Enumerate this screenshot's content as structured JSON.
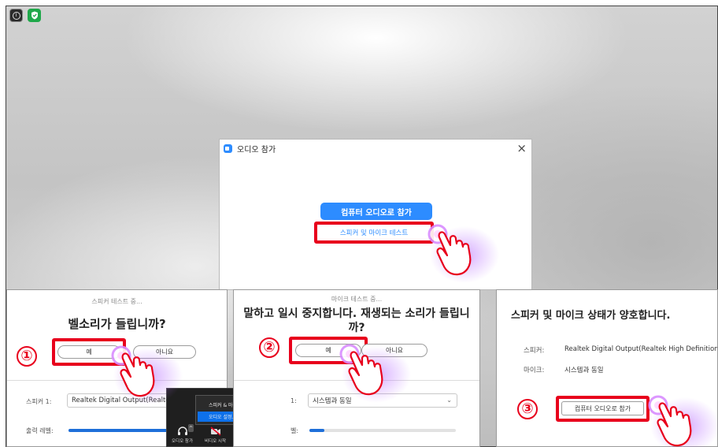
{
  "dialog": {
    "title": "오디오 참가",
    "close_glyph": "×",
    "join_button": "컴퓨터 오디오로 참가",
    "test_link": "스피커 및 마이크 테스트"
  },
  "panel1": {
    "caption": "스피커 테스트 중...",
    "question": "벨소리가 들립니까?",
    "step": "①",
    "yes": "예",
    "no": "아니요",
    "speaker_label": "스피커 1:",
    "speaker_value": "Realtek Digital Output(Realtek",
    "level_label": "출력 레벨:",
    "level_fraction": 0.77
  },
  "toolbar_popup": {
    "menu_items": [
      "스피커 & 마이크 테스트...",
      "오디오 설정..."
    ],
    "selected_index": 1,
    "audio_button": "오디오 참가",
    "video_button": "비디오 시작",
    "caret": "^"
  },
  "panel2": {
    "caption": "마이크 테스트 중...",
    "question_line1": "말하고 일시 중지합니다. 재생되는 소리가 들립니",
    "question_line2": "까?",
    "step": "②",
    "yes": "예",
    "no": "아니요",
    "mic_label": "1:",
    "mic_value": "시스템과 동일",
    "level_label": "벨:",
    "level_fraction": 0.1
  },
  "panel3": {
    "title": "스피커 및 마이크 상태가 양호합니다.",
    "speaker_label": "스피커:",
    "speaker_value": "Realtek Digital Output(Realtek High Definition",
    "mic_label": "마이크:",
    "mic_value": "시스템과 동일",
    "step": "③",
    "join_button": "컴퓨터 오디오로 참가"
  },
  "colors": {
    "highlight_red": "#e8001c",
    "zoom_blue": "#2d8cff",
    "glow_purple": "#b66cff"
  },
  "icons": [
    "info-icon",
    "shield-icon",
    "zoom-logo-icon",
    "close-icon",
    "chevron-down-icon",
    "headphones-icon",
    "video-off-icon",
    "hand-pointer-icon"
  ]
}
